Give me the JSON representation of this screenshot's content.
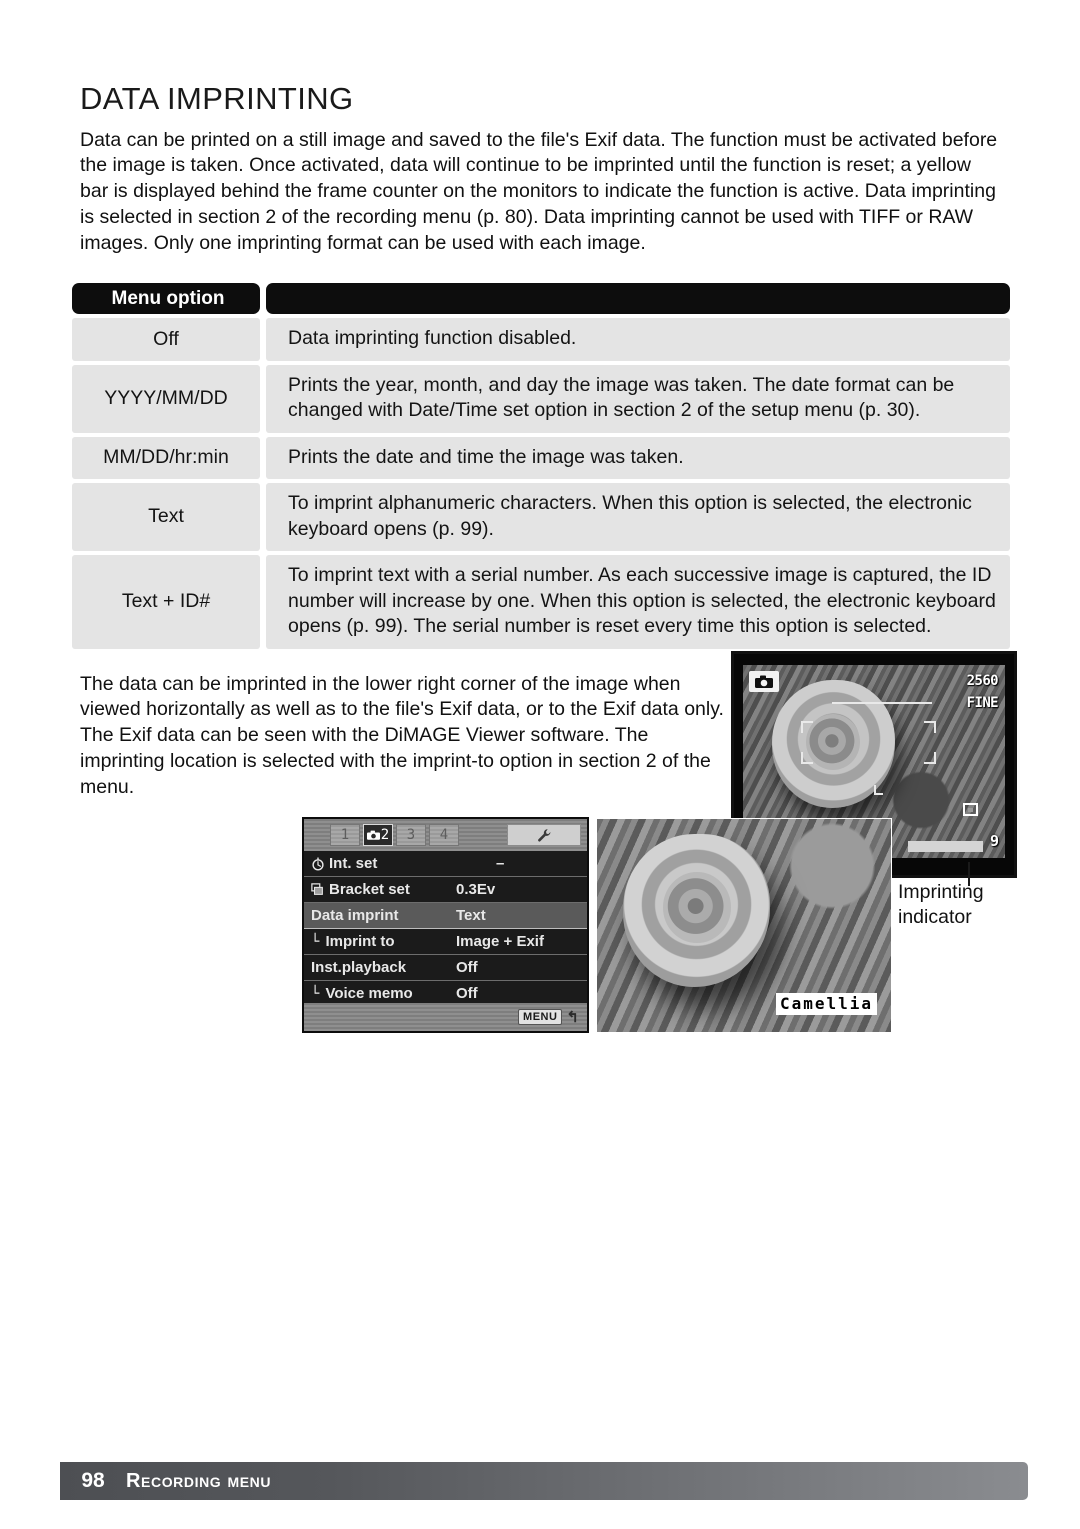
{
  "page": {
    "title": "DATA IMPRINTING",
    "intro": "Data can be printed on a still image and saved to the file's Exif data. The function must be activated before the image is taken. Once activated, data will continue to be imprinted until the function is reset; a yellow bar is displayed behind the frame counter on the monitors to indicate the function is active. Data imprinting is selected in section 2 of the recording menu (p. 80). Data imprinting cannot be used with TIFF or RAW images. Only one imprinting format can be used with each image.",
    "lower_paragraph": "The data can be imprinted in the lower right corner of the image when viewed horizontally as well as to the file's Exif data, or to the Exif data only. The Exif data can be seen with the DiMAGE Viewer software. The imprinting location is selected with the imprint-to option in section 2 of the menu."
  },
  "table": {
    "header": {
      "option_column": "Menu option",
      "description_column": ""
    },
    "rows": [
      {
        "option": "Off",
        "description": "Data imprinting function disabled."
      },
      {
        "option": "YYYY/MM/DD",
        "description": "Prints the year, month, and day the image was taken. The date format can be changed with Date/Time set option in section 2 of the setup menu (p. 30)."
      },
      {
        "option": "MM/DD/hr:min",
        "description": "Prints the date and time the image was taken."
      },
      {
        "option": "Text",
        "description": "To imprint alphanumeric characters. When this option is selected, the electronic keyboard opens (p. 99)."
      },
      {
        "option": "Text + ID#",
        "description": "To imprint text with a serial number. As each successive image is captured, the ID number will increase by one. When this option is selected, the electronic keyboard opens (p. 99). The serial number is reset every time this option is selected."
      }
    ]
  },
  "camera_menu": {
    "tabs": [
      {
        "label": "1",
        "active": false
      },
      {
        "label": "2",
        "active": true,
        "icon": "camera-icon"
      },
      {
        "label": "3",
        "active": false
      },
      {
        "label": "4",
        "active": false
      }
    ],
    "setup_tab_icon": "wrench-icon",
    "items": [
      {
        "label": "Int. set",
        "value": "–",
        "icon": "timer-icon",
        "sub": false,
        "highlight": false
      },
      {
        "label": "Bracket set",
        "value": "0.3Ev",
        "icon": "bracket-icon",
        "sub": false,
        "highlight": false
      },
      {
        "label": "Data imprint",
        "value": "Text",
        "icon": "",
        "sub": false,
        "highlight": true
      },
      {
        "label": "Imprint to",
        "value": "Image + Exif",
        "icon": "",
        "sub": true,
        "highlight": false
      },
      {
        "label": "Inst.playback",
        "value": "Off",
        "icon": "",
        "sub": false,
        "highlight": false
      },
      {
        "label": "Voice memo",
        "value": "Off",
        "icon": "",
        "sub": true,
        "highlight": false
      }
    ],
    "menu_button_label": "MENU",
    "back_arrow_glyph": "↰"
  },
  "live_view": {
    "mode_icon": "camera-icon",
    "resolution": "2560",
    "quality": "FINE",
    "frame_counter": "9",
    "spot_icon": "spot-metering-icon",
    "imprint_bar_name": "imprinting-indicator-bar"
  },
  "callout": {
    "imprinting_indicator": "Imprinting indicator"
  },
  "sample_photo": {
    "imprinted_text": "Camellia"
  },
  "footer": {
    "page_number": "98",
    "section": "Recording menu"
  }
}
